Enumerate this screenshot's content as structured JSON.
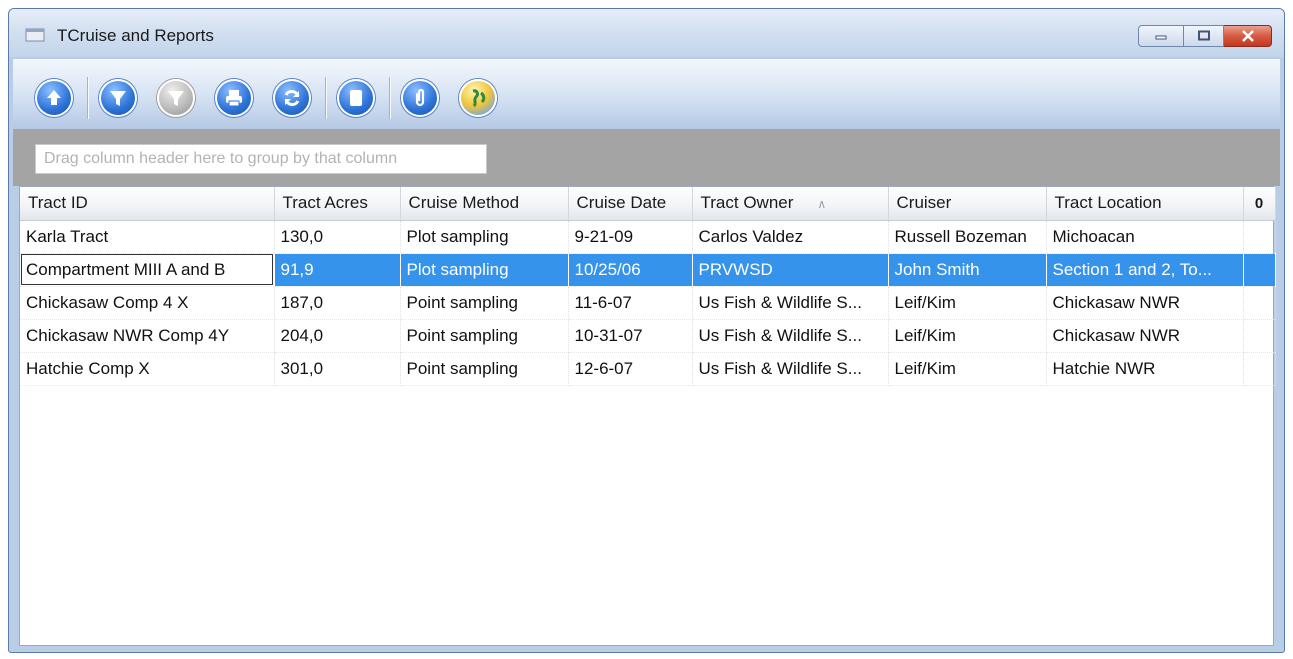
{
  "window": {
    "title": "TCruise and Reports"
  },
  "toolbar": {
    "buttons": [
      {
        "icon": "upload-icon"
      },
      {
        "icon": "filter-icon"
      },
      {
        "icon": "clear-filter-icon"
      },
      {
        "icon": "print-icon"
      },
      {
        "icon": "refresh-icon"
      },
      {
        "icon": "document-icon"
      },
      {
        "icon": "attach-icon"
      },
      {
        "icon": "globe-icon"
      }
    ]
  },
  "group_panel": {
    "hint": "Drag column header here to group by that column"
  },
  "grid": {
    "columns": [
      "Tract ID",
      "Tract Acres",
      "Cruise Method",
      "Cruise Date",
      "Tract Owner",
      "Cruiser",
      "Tract Location"
    ],
    "sort_indicator": "∧",
    "column_chooser": "0",
    "rows": [
      [
        "Karla Tract",
        "130,0",
        "Plot sampling",
        "9-21-09",
        "Carlos Valdez",
        "Russell Bozeman",
        "Michoacan"
      ],
      [
        "Compartment MIII A and B",
        "91,9",
        "Plot sampling",
        "10/25/06",
        "PRVWSD",
        "John Smith",
        "Section 1 and 2, To..."
      ],
      [
        "Chickasaw Comp 4 X",
        "187,0",
        "Point sampling",
        "11-6-07",
        "Us Fish & Wildlife S...",
        "Leif/Kim",
        "Chickasaw NWR"
      ],
      [
        "Chickasaw NWR Comp 4Y",
        "204,0",
        "Point sampling",
        "10-31-07",
        "Us Fish & Wildlife S...",
        "Leif/Kim",
        "Chickasaw NWR"
      ],
      [
        "Hatchie Comp X",
        "301,0",
        "Point sampling",
        "12-6-07",
        "Us Fish & Wildlife S...",
        "Leif/Kim",
        "Hatchie NWR"
      ]
    ],
    "selected_row": 1
  },
  "colors": {
    "selection": "#3593eb",
    "toolbar_button": "#2c73d8",
    "group_panel": "#a4a4a4"
  }
}
